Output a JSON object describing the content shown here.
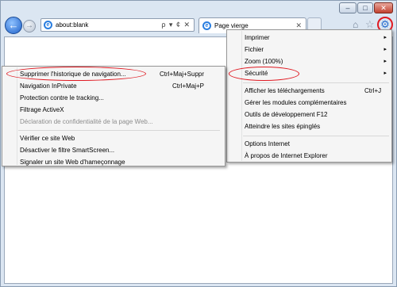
{
  "window": {
    "minimize": "–",
    "maximize": "□",
    "close": "✕"
  },
  "nav": {
    "back_glyph": "←",
    "forward_glyph": "→",
    "address": "about:blank",
    "address_tools": "ρ ▾ ¢ ✕",
    "tab_title": "Page vierge",
    "tab_close": "✕",
    "icons": {
      "home": "⌂",
      "favorites": "☆",
      "tools": "⚙"
    }
  },
  "tools_menu": [
    {
      "label": "Imprimer",
      "arrow": "▸"
    },
    {
      "label": "Fichier",
      "arrow": "▸"
    },
    {
      "label": "Zoom (100%)",
      "arrow": "▸"
    },
    {
      "label": "Sécurité",
      "arrow": "▸"
    },
    {
      "label": "Afficher les téléchargements",
      "shortcut": "Ctrl+J"
    },
    {
      "label": "Gérer les modules complémentaires"
    },
    {
      "label": "Outils de développement F12"
    },
    {
      "label": "Atteindre les sites épinglés"
    },
    {
      "label": "Options Internet"
    },
    {
      "label": "À propos de Internet Explorer"
    }
  ],
  "security_menu": [
    {
      "label": "Supprimer l'historique de navigation...",
      "shortcut": "Ctrl+Maj+Suppr"
    },
    {
      "label": "Navigation InPrivate",
      "shortcut": "Ctrl+Maj+P"
    },
    {
      "label": "Protection contre le tracking..."
    },
    {
      "label": "Filtrage ActiveX"
    },
    {
      "label": "Déclaration de confidentialité de la page Web..."
    },
    {
      "label": "Vérifier ce site Web"
    },
    {
      "label": "Désactiver le filtre SmartScreen..."
    },
    {
      "label": "Signaler un site Web d'hameçonnage"
    }
  ],
  "colors": {
    "highlight_ring": "#e01a22",
    "accent": "#2a7ee0"
  }
}
